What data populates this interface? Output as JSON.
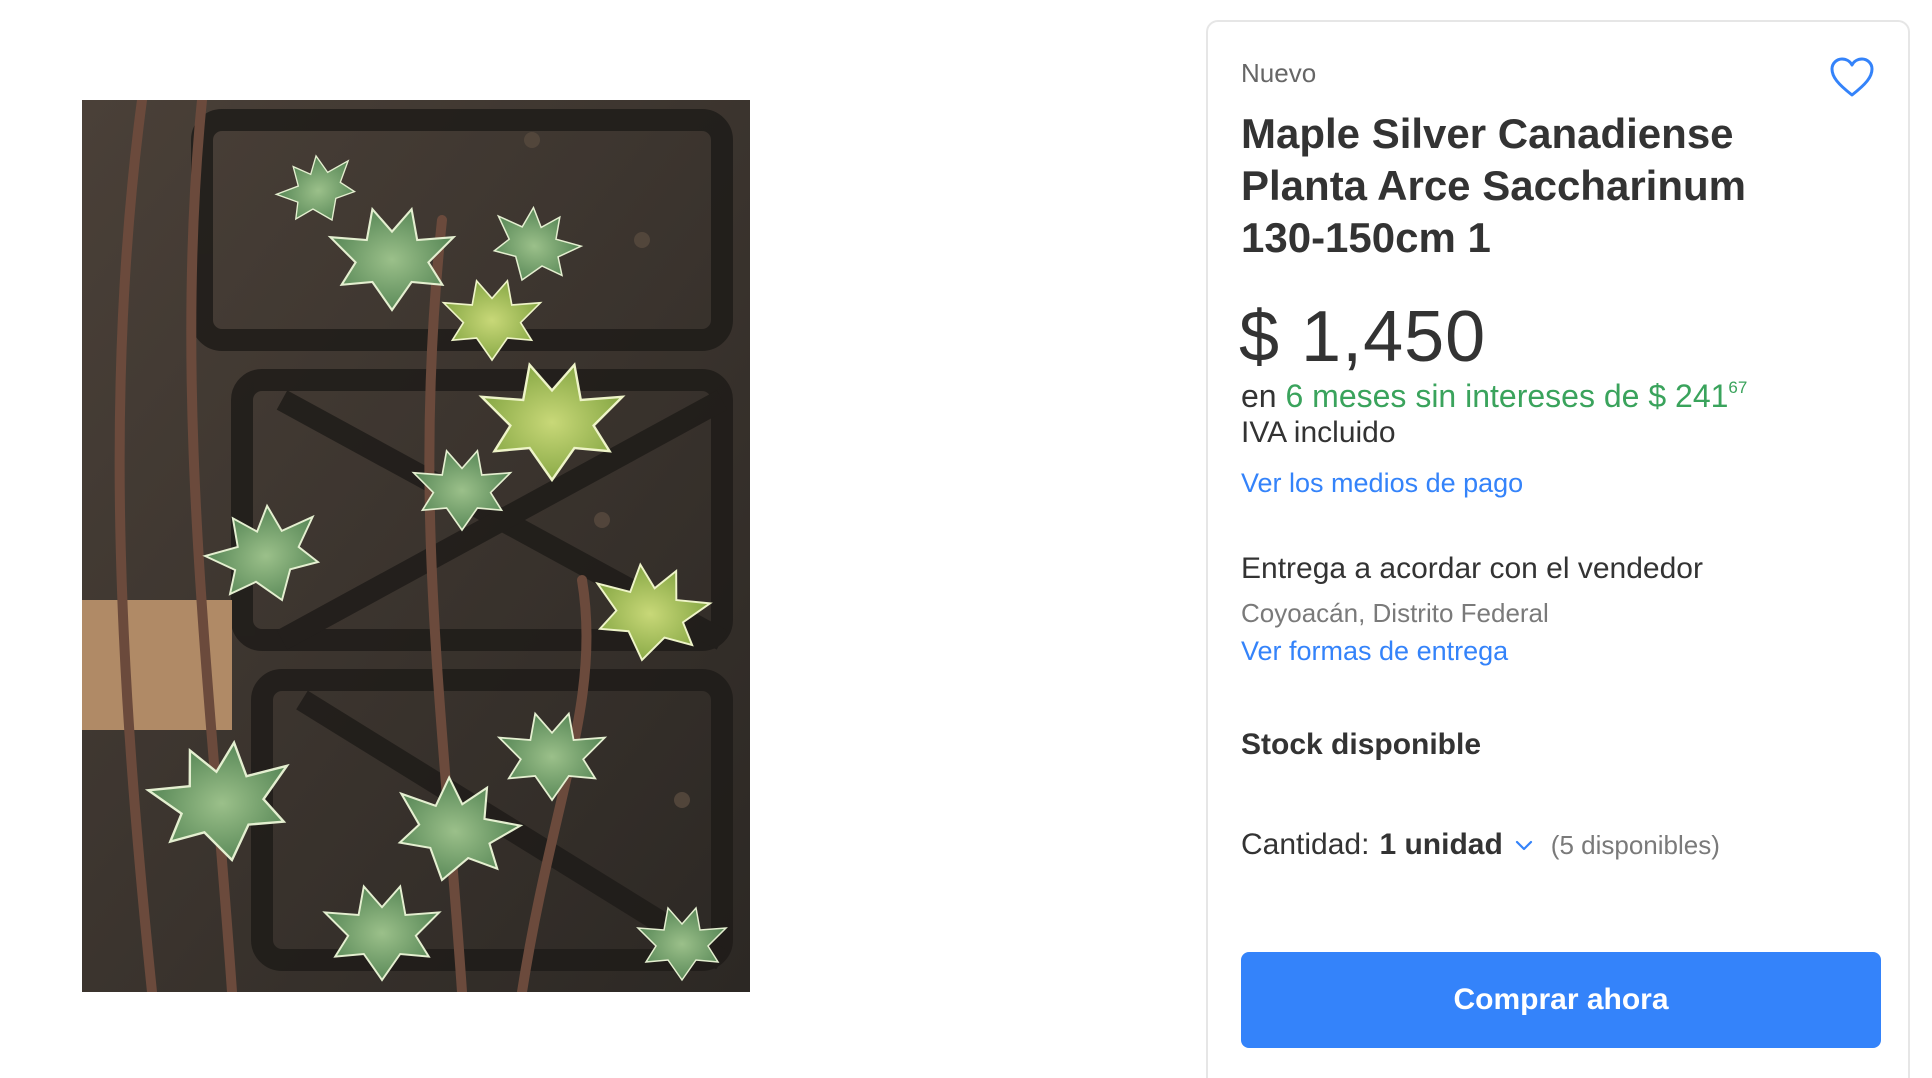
{
  "product": {
    "condition": "Nuevo",
    "title": "Maple Silver Canadiense Planta Arce Saccharinum 130-150cm 1",
    "image_alt": "Planta de arce plateado",
    "favorite_icon": "heart-outline-icon"
  },
  "pricing": {
    "price": "$ 1,450",
    "installments_prefix": "en",
    "installments_offer": "6 meses sin intereses de $ 241",
    "installments_cents": "67",
    "tax_note": "IVA incluido",
    "payment_link": "Ver los medios de pago"
  },
  "delivery": {
    "title": "Entrega a acordar con el vendedor",
    "location": "Coyoacán, Distrito Federal",
    "link": "Ver formas de entrega"
  },
  "stock": {
    "label": "Stock disponible",
    "quantity_label": "Cantidad:",
    "quantity_value": "1 unidad",
    "available": "(5 disponibles)"
  },
  "actions": {
    "buy_label": "Comprar ahora"
  },
  "colors": {
    "accent": "#3483fa",
    "installments_green": "#3aa35c",
    "text": "#333333",
    "muted": "#7a7a7a"
  }
}
